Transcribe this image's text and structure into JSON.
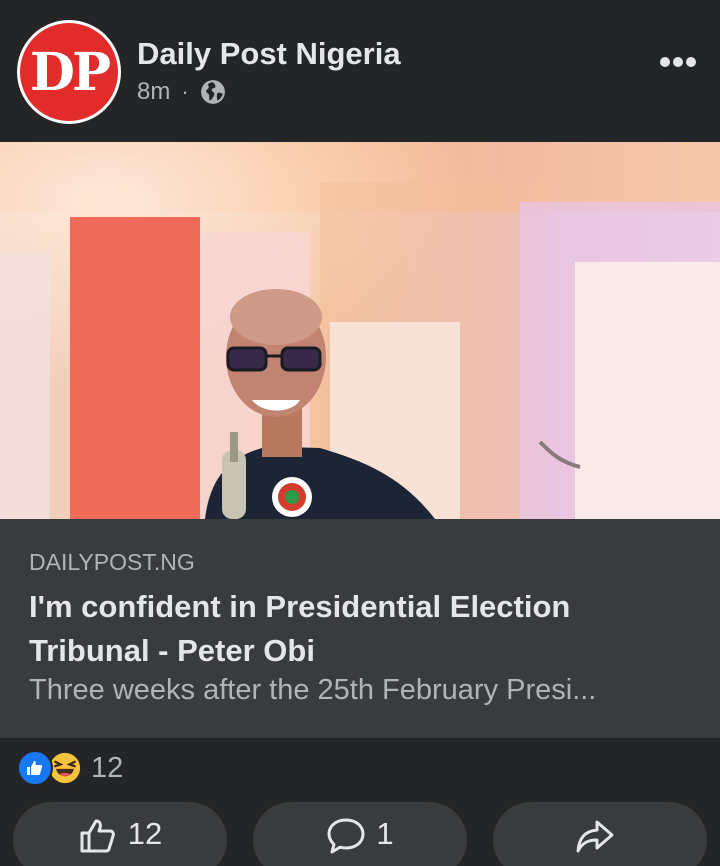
{
  "post": {
    "page_name": "Daily Post Nigeria",
    "avatar_text": "DP",
    "time": "8m",
    "separator": "·",
    "privacy_icon": "globe-icon",
    "more_icon": "more-dots-icon"
  },
  "link": {
    "domain": "DAILYPOST.NG",
    "title": "I'm confident in Presidential Election Tribunal - Peter Obi",
    "description": "Three weeks after the 25th February Presi..."
  },
  "reactions": {
    "types": [
      "like",
      "haha"
    ],
    "count": "12"
  },
  "actions": {
    "like_count": "12",
    "comment_count": "1",
    "like_icon": "thumbs-up-icon",
    "comment_icon": "comment-bubble-icon",
    "share_icon": "share-arrow-icon"
  },
  "colors": {
    "background": "#242526",
    "link_box": "#3a3b3c",
    "brand_red": "#e22b2b",
    "like_blue": "#1877f2"
  }
}
